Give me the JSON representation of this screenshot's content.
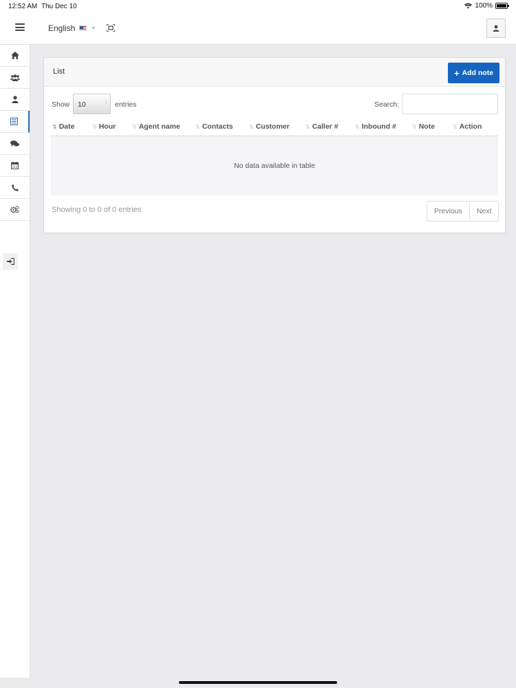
{
  "status_bar": {
    "time": "12:52 AM",
    "date": "Thu Dec 10",
    "battery": "100%"
  },
  "topbar": {
    "language": "English"
  },
  "sidebar": {
    "items": [
      {
        "icon": "home-icon"
      },
      {
        "icon": "users-icon"
      },
      {
        "icon": "user-icon"
      },
      {
        "icon": "list-icon",
        "active": true
      },
      {
        "icon": "chat-icon"
      },
      {
        "icon": "calendar-icon"
      },
      {
        "icon": "phone-icon"
      },
      {
        "icon": "gears-icon"
      }
    ],
    "logout_icon": "sign-out-icon"
  },
  "panel": {
    "title": "List",
    "add_button": "Add note",
    "show_label": "Show",
    "page_size": "10",
    "entries_label": "entries",
    "search_label": "Search:",
    "search_value": "",
    "columns": [
      "Date",
      "Hour",
      "Agent name",
      "Contacts",
      "Customer",
      "Caller #",
      "Inbound #",
      "Note",
      "Action"
    ],
    "empty_text": "No data available in table",
    "info": "Showing 0 to 0 of 0 entries",
    "prev_label": "Previous",
    "next_label": "Next"
  },
  "colors": {
    "primary": "#1565c0",
    "active_bar": "#2b6cb0",
    "background": "#ebebee"
  }
}
